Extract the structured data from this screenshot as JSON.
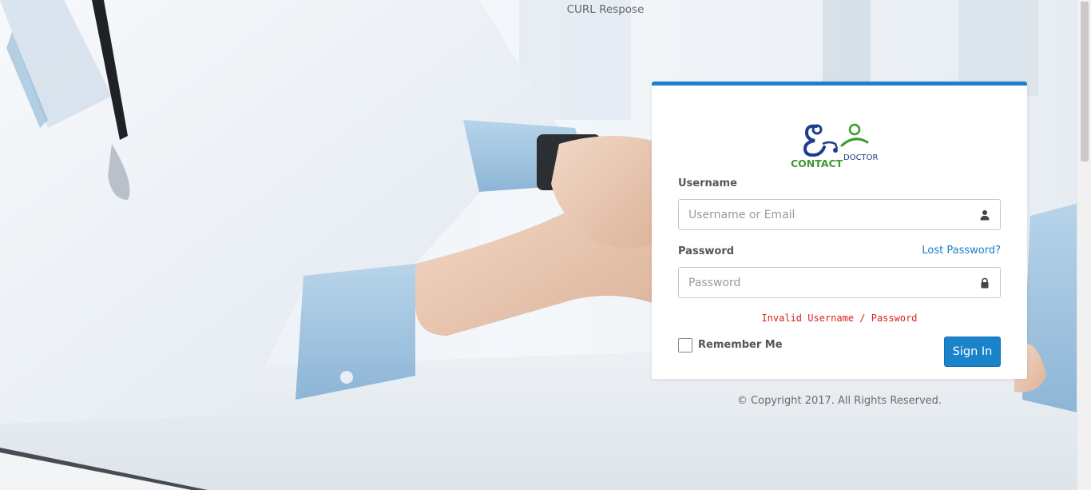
{
  "header": {
    "curl_text": "CURL Respose"
  },
  "logo": {
    "word_contact": "CONTACT",
    "word_doctor": "DOCTOR"
  },
  "form": {
    "username_label": "Username",
    "username_placeholder": "Username or Email",
    "username_value": "",
    "username_icon": "user-icon",
    "password_label": "Password",
    "password_placeholder": "Password",
    "password_value": "",
    "password_icon": "lock-icon",
    "lost_password": "Lost Password?",
    "error_message": "Invalid Username / Password",
    "remember_label": "Remember Me",
    "remember_checked": false,
    "signin_label": "Sign In"
  },
  "footer": {
    "copyright": "© Copyright 2017. All Rights Reserved."
  },
  "colors": {
    "accent": "#1a83c9",
    "link": "#1a7fc2",
    "error": "#d9231d",
    "logo_navy": "#1d3f8a",
    "logo_green": "#3c9a2e"
  }
}
